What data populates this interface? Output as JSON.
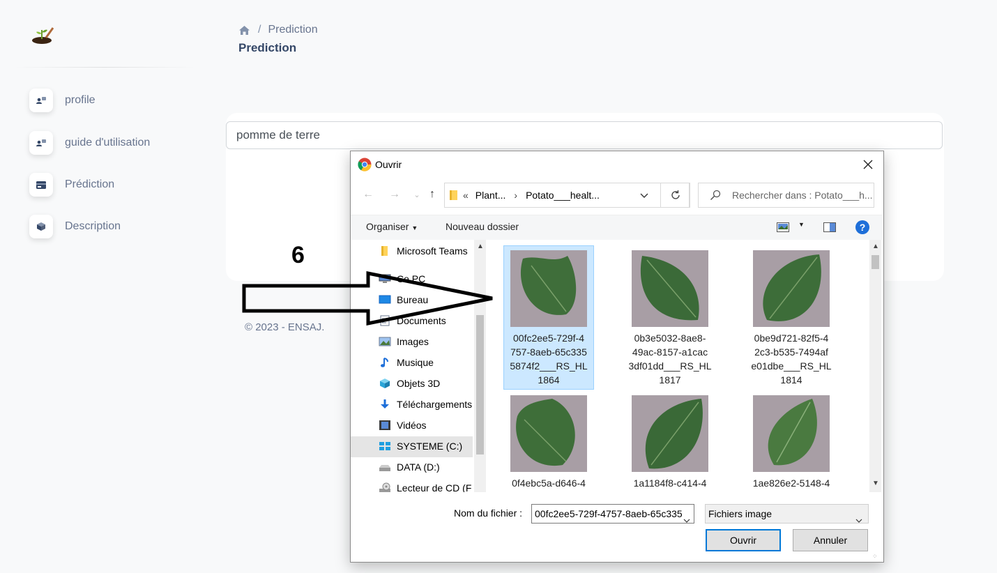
{
  "sidebar": {
    "items": [
      {
        "label": "profile",
        "icon": "user-icon"
      },
      {
        "label": "guide d'utilisation",
        "icon": "user-icon"
      },
      {
        "label": "Prédiction",
        "icon": "card-icon"
      },
      {
        "label": "Description",
        "icon": "box-icon"
      }
    ]
  },
  "breadcrumb": {
    "current": "Prediction"
  },
  "page_title": "Prediction",
  "plant_input": {
    "value": "pomme de terre"
  },
  "annotation": {
    "step": "6"
  },
  "footer": {
    "text": "© 2023  - ENSAJ."
  },
  "dialog": {
    "title": "Ouvrir",
    "address": {
      "part1": "Plant...",
      "part2": "Potato___healt..."
    },
    "search_placeholder": "Rechercher dans : Potato___h...",
    "toolbar": {
      "organize": "Organiser",
      "new_folder": "Nouveau dossier"
    },
    "tree": [
      {
        "label": "Microsoft Teams",
        "icon": "folder-icon"
      },
      {
        "label": "Ce PC",
        "icon": "pc-icon"
      },
      {
        "label": "Bureau",
        "icon": "desktop-icon"
      },
      {
        "label": "Documents",
        "icon": "documents-icon"
      },
      {
        "label": "Images",
        "icon": "images-icon"
      },
      {
        "label": "Musique",
        "icon": "music-icon"
      },
      {
        "label": "Objets 3D",
        "icon": "cube-icon"
      },
      {
        "label": "Téléchargements",
        "icon": "download-icon"
      },
      {
        "label": "Vidéos",
        "icon": "video-icon"
      },
      {
        "label": "SYSTEME (C:)",
        "icon": "drive-icon"
      },
      {
        "label": "DATA (D:)",
        "icon": "drive-icon"
      },
      {
        "label": "Lecteur de CD (F",
        "icon": "cd-icon"
      }
    ],
    "files": [
      {
        "name": "00fc2ee5-729f-4\n757-8aeb-65c335\n5874f2___RS_HL\n1864",
        "selected": true
      },
      {
        "name": "0b3e5032-8ae8-\n49ac-8157-a1cac\n3df01dd___RS_HL\n1817",
        "selected": false
      },
      {
        "name": "0be9d721-82f5-4\n2c3-b535-7494af\ne01dbe___RS_HL\n1814",
        "selected": false
      },
      {
        "name": "0f4ebc5a-d646-4",
        "selected": false
      },
      {
        "name": "1a1184f8-c414-4",
        "selected": false
      },
      {
        "name": "1ae826e2-5148-4",
        "selected": false
      }
    ],
    "filename_label": "Nom du fichier :",
    "filename_value": "00fc2ee5-729f-4757-8aeb-65c335",
    "filetype": "Fichiers image",
    "open_label": "Ouvrir",
    "cancel_label": "Annuler"
  }
}
